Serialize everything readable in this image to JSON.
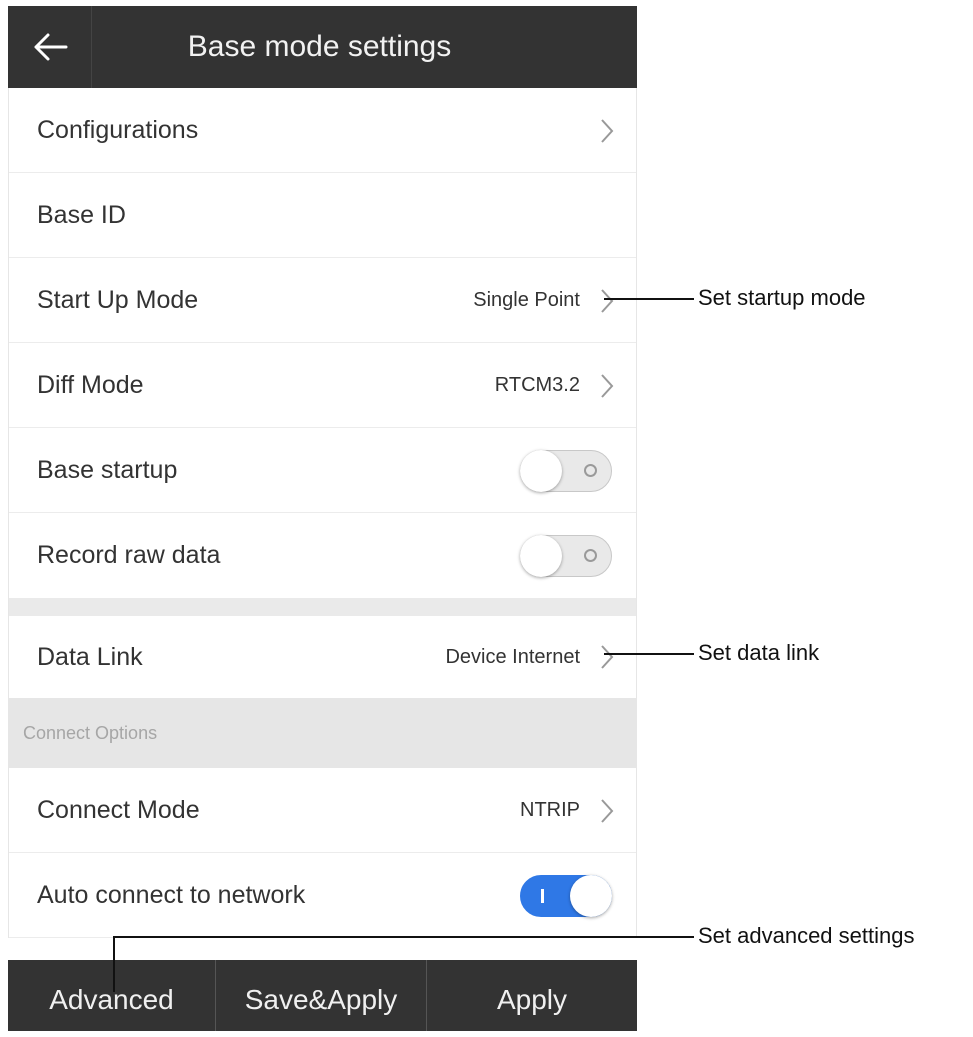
{
  "header": {
    "title": "Base mode settings",
    "back_icon": "arrow-left-icon"
  },
  "rows": {
    "configurations": {
      "label": "Configurations"
    },
    "base_id": {
      "label": "Base ID"
    },
    "start_up_mode": {
      "label": "Start Up Mode",
      "value": "Single Point"
    },
    "diff_mode": {
      "label": "Diff Mode",
      "value": "RTCM3.2"
    },
    "base_startup": {
      "label": "Base startup",
      "state": "off"
    },
    "record_raw_data": {
      "label": "Record raw data",
      "state": "off"
    },
    "data_link": {
      "label": "Data Link",
      "value": "Device Internet"
    },
    "connect_mode": {
      "label": "Connect Mode",
      "value": "NTRIP"
    },
    "auto_connect": {
      "label": "Auto connect to network",
      "state": "on"
    }
  },
  "section": {
    "connect_options": "Connect Options"
  },
  "footer": {
    "advanced": "Advanced",
    "save_apply": "Save&Apply",
    "apply": "Apply"
  },
  "annotations": {
    "startup_mode": "Set startup mode",
    "data_link": "Set data link",
    "advanced": "Set advanced settings"
  },
  "colors": {
    "header_bg": "#333333",
    "toggle_on": "#2f78e6",
    "section_bg": "#e6e6e6"
  }
}
